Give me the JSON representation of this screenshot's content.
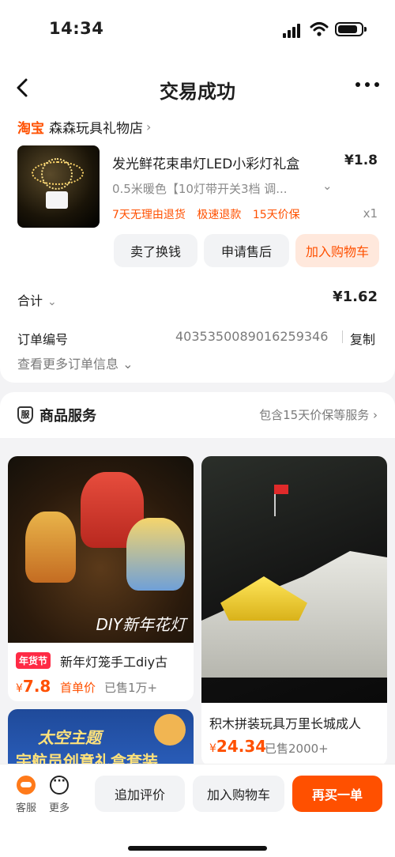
{
  "status": {
    "time": "14:34"
  },
  "nav": {
    "title": "交易成功"
  },
  "shop": {
    "brand": "淘宝",
    "name": "森森玩具礼物店"
  },
  "product": {
    "title": "发光鲜花束串灯LED小彩灯礼盒",
    "price": "¥1.8",
    "spec": "0.5米暖色【10灯带开关3档 调...",
    "tags": [
      "7天无理由退货",
      "极速退款",
      "15天价保"
    ],
    "qty": "x1"
  },
  "actions": {
    "sell": "卖了换钱",
    "after": "申请售后",
    "cart": "加入购物车"
  },
  "summary": {
    "label": "合计",
    "value": "¥1.62"
  },
  "order": {
    "label": "订单编号",
    "number": "4035350089016259346",
    "copy": "复制",
    "more": "查看更多订单信息"
  },
  "service": {
    "title": "商品服务",
    "info": "包含15天价保等服务"
  },
  "feed": [
    {
      "tag": "年货节",
      "title": "新年灯笼手工diy古",
      "price_prefix": "¥",
      "price": "7.8",
      "first_price": "首单价",
      "sold": "已售1万+",
      "image_text": "DIY新年花灯"
    },
    {
      "title": "积木拼装玩具万里长城成人",
      "price_prefix": "¥",
      "price": "24.34",
      "sold": "已售2000+"
    },
    {
      "image_text_1": "太空主题",
      "image_text_2": "宇航员创意礼盒套装"
    }
  ],
  "bottom": {
    "kefu": "客服",
    "more": "更多",
    "review": "追加评价",
    "addcart": "加入购物车",
    "rebuy": "再买一单"
  },
  "colors": {
    "accent": "#ff5000",
    "tag_red": "#ff2a45",
    "cart_bg": "#ffe8dc"
  }
}
